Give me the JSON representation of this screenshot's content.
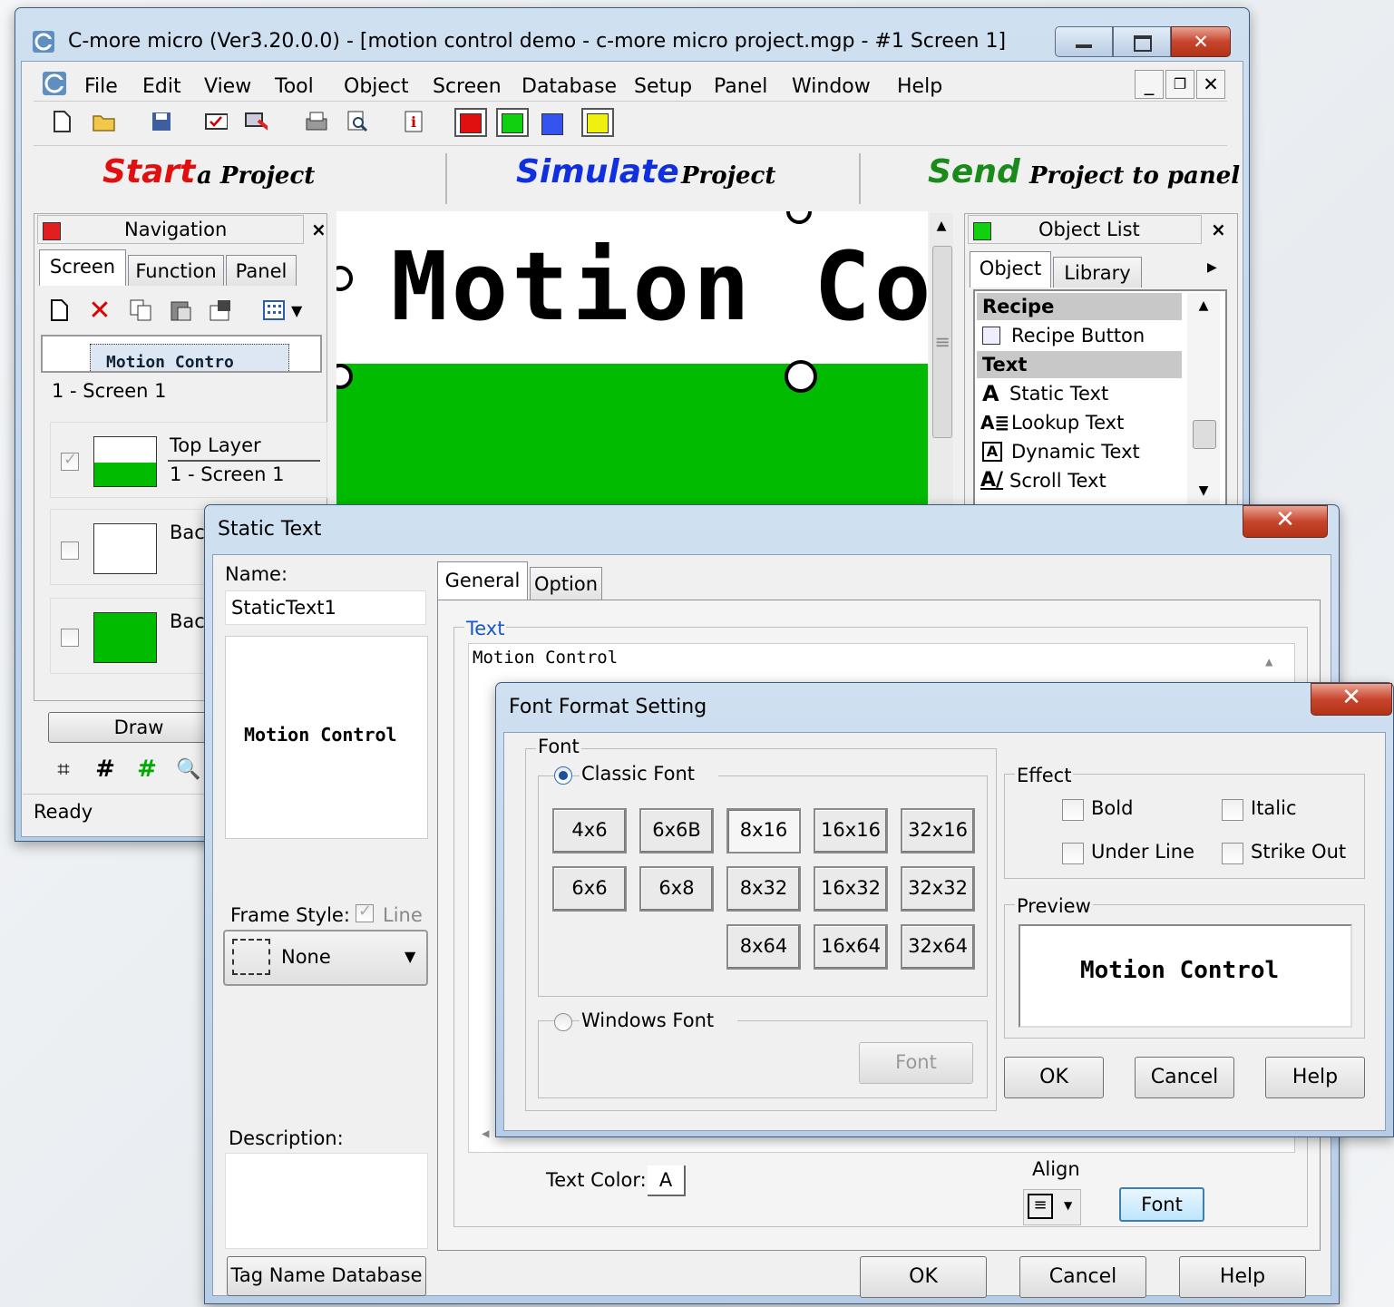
{
  "main_window": {
    "title": "C-more micro (Ver3.20.0.0) - [motion control demo - c-more micro project.mgp - #1 Screen 1]",
    "menu": [
      "File",
      "Edit",
      "View",
      "Tool",
      "Object",
      "Screen",
      "Database",
      "Setup",
      "Panel",
      "Window",
      "Help"
    ],
    "banner": {
      "start": "Start",
      "start_rest": "a Project",
      "simulate": "Simulate",
      "simulate_rest": "Project",
      "send": "Send",
      "send_rest": "Project to panel"
    },
    "navigation": {
      "title": "Navigation",
      "tabs": [
        "Screen",
        "Function",
        "Panel"
      ],
      "thumb_text": "Motion Contro",
      "screen_label": "1 - Screen 1",
      "layers": [
        {
          "name": "Top Layer",
          "sub": "1 - Screen 1"
        },
        {
          "name": "Bac"
        },
        {
          "name": "Bac"
        }
      ],
      "draw_button": "Draw"
    },
    "canvas": {
      "text": "Motion Co"
    },
    "object_list": {
      "title": "Object List",
      "tabs": [
        "Object",
        "Library"
      ],
      "items": [
        {
          "label": "Recipe",
          "header": true
        },
        {
          "label": "Recipe Button",
          "icon": "recipe-button-icon"
        },
        {
          "label": "Text",
          "header": true
        },
        {
          "label": "Static Text",
          "icon": "static-text-icon"
        },
        {
          "label": "Lookup Text",
          "icon": "lookup-text-icon"
        },
        {
          "label": "Dynamic Text",
          "icon": "dynamic-text-icon"
        },
        {
          "label": "Scroll Text",
          "icon": "scroll-text-icon"
        }
      ]
    },
    "status": "Ready"
  },
  "static_text_dialog": {
    "title": "Static Text",
    "name_label": "Name:",
    "name_value": "StaticText1",
    "preview_text": "Motion Control",
    "frame_style_label": "Frame Style:",
    "line_label": "Line",
    "frame_value": "None",
    "description_label": "Description:",
    "tag_button": "Tag Name Database",
    "tabs": [
      "General",
      "Option"
    ],
    "text_group": "Text",
    "text_value": "Motion Control",
    "text_color_label": "Text Color:",
    "text_color_glyph": "A",
    "align_label": "Align",
    "font_button": "Font",
    "ok": "OK",
    "cancel": "Cancel",
    "help": "Help"
  },
  "font_dialog": {
    "title": "Font Format Setting",
    "font_group": "Font",
    "classic_font": "Classic Font",
    "sizes": [
      "4x6",
      "6x6B",
      "8x16",
      "16x16",
      "32x16",
      "6x6",
      "6x8",
      "8x32",
      "16x32",
      "32x32",
      "8x64",
      "16x64",
      "32x64"
    ],
    "windows_font": "Windows Font",
    "font_button": "Font",
    "effect_group": "Effect",
    "effects": [
      "Bold",
      "Italic",
      "Under Line",
      "Strike Out"
    ],
    "preview_group": "Preview",
    "preview_text": "Motion Control",
    "ok": "OK",
    "cancel": "Cancel",
    "help": "Help"
  }
}
